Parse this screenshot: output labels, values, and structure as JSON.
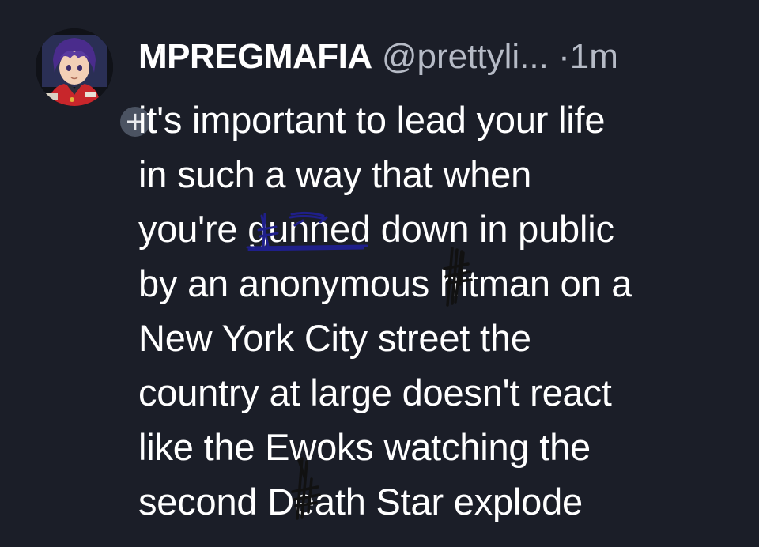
{
  "post": {
    "display_name": "MPREGMAFIA",
    "handle": "@prettyli...",
    "separator": "·",
    "time": "1m",
    "follow_symbol": "+",
    "avatar_icon": "anime-avatar-icon",
    "text_lines": [
      {
        "pre": "it's important to lead your life",
        "word": "",
        "post": ""
      },
      {
        "pre": "in such a way that when",
        "word": "",
        "post": ""
      },
      {
        "pre": "you're ",
        "word": "gunned",
        "post": " down in public"
      },
      {
        "pre": "by an anonymous ",
        "word": "hitman",
        "post": " on a"
      },
      {
        "pre": "New York City street the",
        "word": "",
        "post": ""
      },
      {
        "pre": "country at large doesn't react",
        "word": "",
        "post": ""
      },
      {
        "pre": "like the Ewoks watching the",
        "word": "",
        "post": ""
      },
      {
        "pre": "second ",
        "word": "Death",
        "post": " Star explode"
      }
    ],
    "scribble_color": "#1f1f8a"
  }
}
